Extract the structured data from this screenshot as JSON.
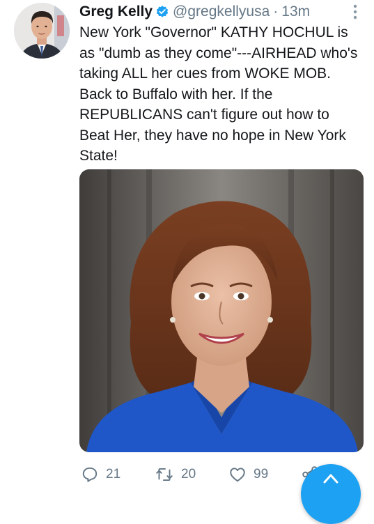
{
  "tweet": {
    "display_name": "Greg Kelly",
    "handle": "@gregkellyusa",
    "separator": "·",
    "timestamp": "13m",
    "text": "New York \"Governor\" KATHY HOCHUL is as \"dumb as they come\"---AIRHEAD who's taking ALL her cues from WOKE MOB. Back to Buffalo with her. If the REPUBLICANS can't figure out how to Beat Her, they have no hope in New York State!",
    "verified": true
  },
  "actions": {
    "reply_count": "21",
    "retweet_count": "20",
    "like_count": "99"
  },
  "icons": {
    "verified": "verified-badge-icon",
    "more": "more-vertical-icon",
    "reply": "reply-bubble-icon",
    "retweet": "retweet-icon",
    "like": "heart-icon",
    "share": "share-icon",
    "compose": "compose-fab-icon"
  },
  "colors": {
    "accent": "#1da1f2",
    "text_primary": "#14171a",
    "text_secondary": "#657786"
  }
}
